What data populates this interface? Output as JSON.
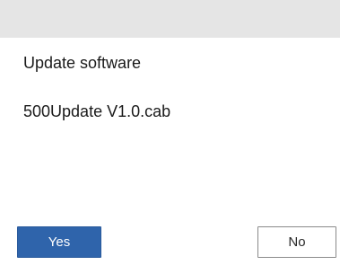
{
  "dialog": {
    "prompt": "Update software",
    "filename": "500Update V1.0.cab"
  },
  "buttons": {
    "yes_label": "Yes",
    "no_label": "No"
  },
  "colors": {
    "title_bar": "#e5e5e5",
    "primary_button": "#2f64ab",
    "secondary_border": "#8a8a8a"
  }
}
